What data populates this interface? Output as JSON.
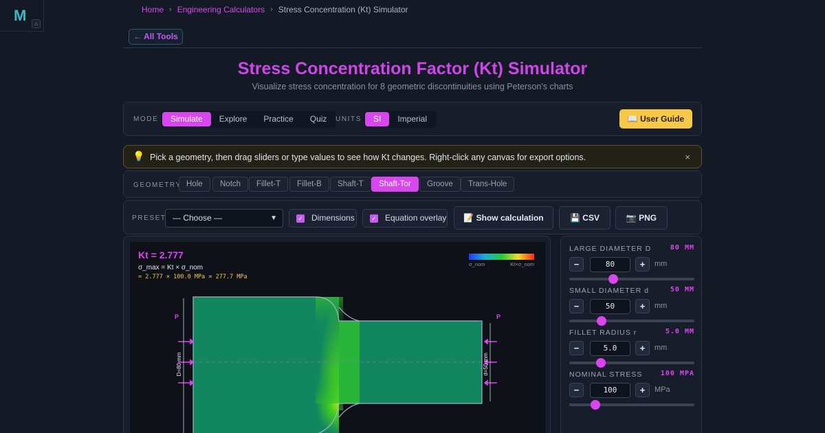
{
  "app": {
    "logo_letter": "M",
    "home_icon": "home-icon"
  },
  "breadcrumb": {
    "home": "Home",
    "category": "Engineering Calculators",
    "current": "Stress Concentration (Kt) Simulator",
    "separator": "›"
  },
  "nav": {
    "all_tools_label": "← All Tools"
  },
  "header": {
    "title": "Stress Concentration Factor (Kt) Simulator",
    "subtitle": "Visualize stress concentration for 8 geometric discontinuities using Peterson's charts"
  },
  "mode_bar": {
    "mode_caption": "MODE",
    "modes": [
      "Simulate",
      "Explore",
      "Practice",
      "Quiz"
    ],
    "active_mode": "Simulate",
    "units_caption": "UNITS",
    "units": [
      "SI",
      "Imperial"
    ],
    "active_unit": "SI",
    "guide_label": "📖 User Guide"
  },
  "tip": {
    "icon": "lightbulb-icon",
    "text": "Pick a geometry, then drag sliders or type values to see how Kt changes. Right-click any canvas for export options.",
    "close": "×"
  },
  "geometry": {
    "caption": "GEOMETRY",
    "options": [
      "Hole",
      "Notch",
      "Fillet-T",
      "Fillet-B",
      "Shaft-T",
      "Shaft-Tor",
      "Groove",
      "Trans-Hole"
    ],
    "active": "Shaft-Tor"
  },
  "toolbar": {
    "preset_caption": "PRESET",
    "preset_value": "— Choose —",
    "dimensions_label": "Dimensions",
    "dimensions_checked": true,
    "equation_label": "Equation overlay",
    "equation_checked": true,
    "calc_label": "📝 Show calculation",
    "csv_label": "💾 CSV",
    "png_label": "📷 PNG"
  },
  "canvas": {
    "kt_label": "Kt = 2.777",
    "formula": "σ_max = Kt × σ_nom",
    "computation": "= 2.777 × 100.0 MPa = 277.7 MPa",
    "legend_min": "σ_nom",
    "legend_max": "Kt×σ_nom",
    "load_left": "P",
    "load_right": "P",
    "dim_large": "D=80 mm",
    "dim_small": "d=50 mm",
    "colors": {
      "base": "#12865f",
      "hot": "#3ed11c",
      "accent": "#d946ef"
    }
  },
  "params": [
    {
      "name": "LARGE DIAMETER D",
      "display": "80 MM",
      "value": "80",
      "unit": "mm",
      "fraction": 0.35
    },
    {
      "name": "SMALL DIAMETER d",
      "display": "50 MM",
      "value": "50",
      "unit": "mm",
      "fraction": 0.26
    },
    {
      "name": "FILLET RADIUS r",
      "display": "5.0 MM",
      "value": "5.0",
      "unit": "mm",
      "fraction": 0.25
    },
    {
      "name": "NOMINAL STRESS",
      "display": "100 MPA",
      "value": "100",
      "unit": "MPa",
      "fraction": 0.21
    }
  ]
}
